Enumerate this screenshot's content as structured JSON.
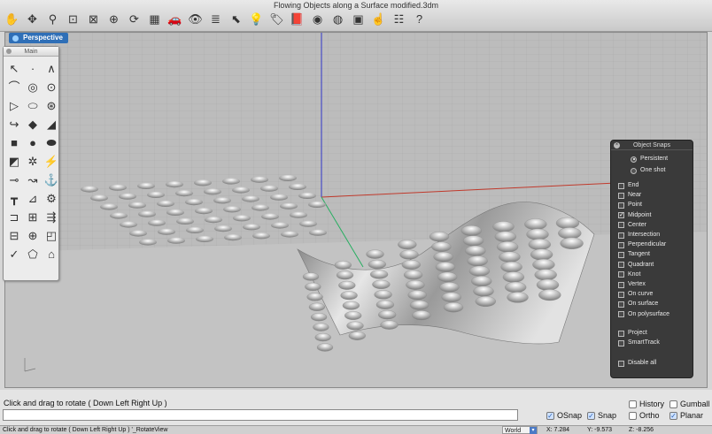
{
  "window": {
    "title": "Flowing Objects along a Surface modified.3dm"
  },
  "toolbar": {
    "icons": [
      "pan-hand-icon",
      "move-cross-icon",
      "zoom-icon",
      "zoom-window-icon",
      "zoom-extents-icon",
      "zoom-selected-icon",
      "rotate-view-icon",
      "four-viewports-icon",
      "car-render-icon",
      "shaded-eye-icon",
      "layers-icon",
      "select-arrow-icon",
      "light-bulb-icon",
      "tag-icon",
      "book-icon",
      "color-wheel-icon",
      "sphere-icon",
      "object-properties-icon",
      "hand-pointer-icon",
      "options-icon",
      "help-icon"
    ],
    "glyphs": [
      "✋",
      "✥",
      "⚲",
      "⊡",
      "⊠",
      "⊕",
      "⟳",
      "▦",
      "🚗",
      "👁",
      "≣",
      "⬉",
      "💡",
      "🏷",
      "📕",
      "◉",
      "◍",
      "▣",
      "☝",
      "☷",
      "?"
    ]
  },
  "viewport": {
    "label": "Perspective"
  },
  "palette": {
    "title": "Main",
    "tools": [
      "↖",
      "·",
      "∧",
      "⌒",
      "◎",
      "⊙",
      "▷",
      "⬭",
      "⊛",
      "↪",
      "◆",
      "◢",
      "■",
      "●",
      "⬬",
      "◩",
      "✲",
      "⚡",
      "⊸",
      "↝",
      "⚓",
      "┳",
      "⊿",
      "⚙",
      "⊐",
      "⊞",
      "⇶",
      "⊟",
      "⊕",
      "◰",
      "✓",
      "⬠",
      "⌂"
    ]
  },
  "snaps": {
    "title": "Object Snaps",
    "mode": [
      {
        "label": "Persistent",
        "selected": true
      },
      {
        "label": "One shot",
        "selected": false
      }
    ],
    "items": [
      {
        "label": "End",
        "checked": false
      },
      {
        "label": "Near",
        "checked": false
      },
      {
        "label": "Point",
        "checked": false
      },
      {
        "label": "Midpoint",
        "checked": true
      },
      {
        "label": "Center",
        "checked": false
      },
      {
        "label": "Intersection",
        "checked": false
      },
      {
        "label": "Perpendicular",
        "checked": false
      },
      {
        "label": "Tangent",
        "checked": false
      },
      {
        "label": "Quadrant",
        "checked": false
      },
      {
        "label": "Knot",
        "checked": false
      },
      {
        "label": "Vertex",
        "checked": false
      },
      {
        "label": "On curve",
        "checked": false
      },
      {
        "label": "On surface",
        "checked": false
      },
      {
        "label": "On polysurface",
        "checked": false
      }
    ],
    "extra": [
      {
        "label": "Project",
        "checked": false
      },
      {
        "label": "SmartTrack",
        "checked": false
      }
    ],
    "disable_all": {
      "label": "Disable all",
      "checked": false
    }
  },
  "command": {
    "prompt": "Click and drag to rotate ( Down Left Right Up )",
    "input_value": ""
  },
  "toggles": {
    "osnap": {
      "label": "OSnap",
      "checked": true
    },
    "snap": {
      "label": "Snap",
      "checked": true
    },
    "history": {
      "label": "History",
      "checked": false
    },
    "ortho": {
      "label": "Ortho",
      "checked": false
    },
    "gumball": {
      "label": "Gumball",
      "checked": false
    },
    "planar": {
      "label": "Planar",
      "checked": true
    }
  },
  "status": {
    "history": "Click and drag to rotate ( Down Left Right Up ) '_RotateView",
    "cplane": "World",
    "x": "X: 7.284",
    "y": "Y: -9.573",
    "z": "Z: -8.256"
  },
  "colors": {
    "x_axis": "#c0392b",
    "y_axis": "#27ae60",
    "z_axis": "#2f36c9",
    "tab": "#2f6fb7"
  }
}
